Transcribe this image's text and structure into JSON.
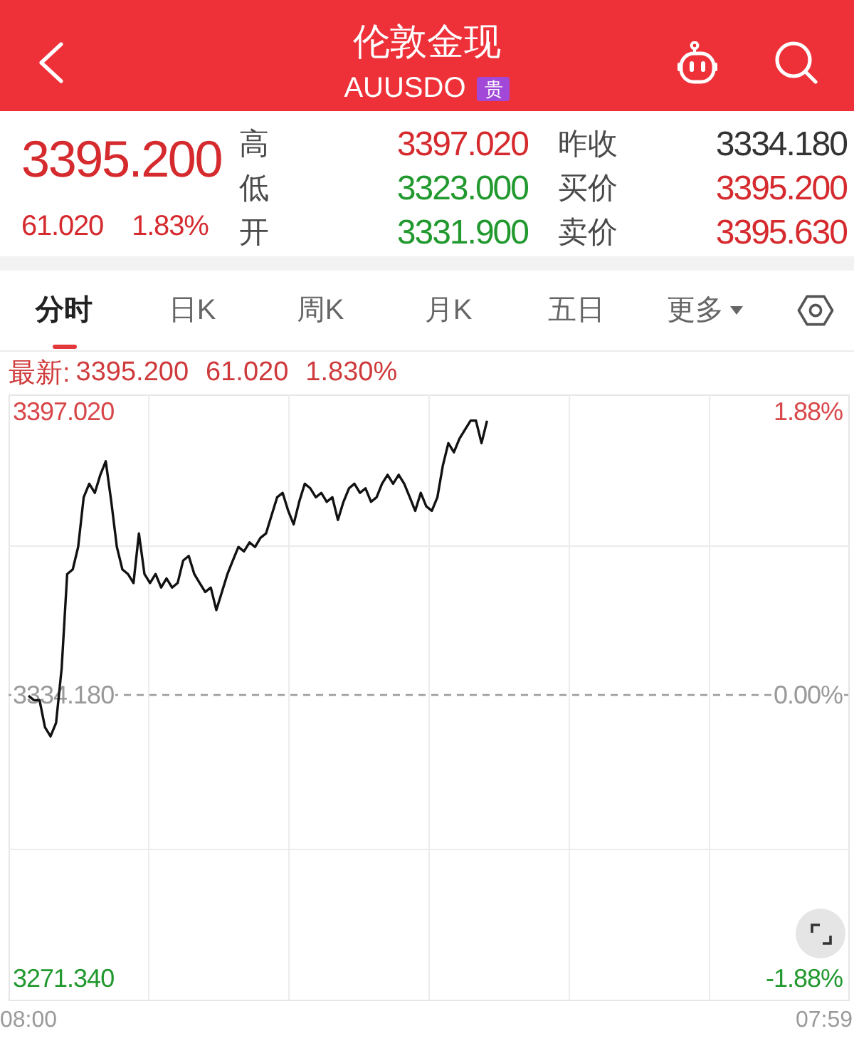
{
  "header": {
    "title": "伦敦金现",
    "symbol": "AUUSDO",
    "badge": "贵"
  },
  "quote": {
    "price": "3395.200",
    "change": "61.020",
    "percent": "1.83%",
    "color": "#d52a2e",
    "stats": [
      {
        "label": "高",
        "value": "3397.020",
        "color": "#d52a2e"
      },
      {
        "label": "昨收",
        "value": "3334.180",
        "color": "#333333"
      },
      {
        "label": "低",
        "value": "3323.000",
        "color": "#22992f"
      },
      {
        "label": "买价",
        "value": "3395.200",
        "color": "#d52a2e"
      },
      {
        "label": "开",
        "value": "3331.900",
        "color": "#22992f"
      },
      {
        "label": "卖价",
        "value": "3395.630",
        "color": "#d52a2e"
      }
    ]
  },
  "tabs": [
    {
      "label": "分时",
      "selected": true,
      "kind": "tab"
    },
    {
      "label": "日K",
      "selected": false,
      "kind": "tab"
    },
    {
      "label": "周K",
      "selected": false,
      "kind": "tab"
    },
    {
      "label": "月K",
      "selected": false,
      "kind": "tab"
    },
    {
      "label": "五日",
      "selected": false,
      "kind": "tab"
    },
    {
      "label": "更多",
      "selected": false,
      "kind": "menu"
    }
  ],
  "latest": {
    "label": "最新:",
    "price": "3395.200",
    "change": "61.020",
    "percent": "1.830%",
    "color": "#cf3a3c"
  },
  "chart": {
    "right_labels": [
      "1.88%",
      "0.00%",
      "-1.88%"
    ],
    "chart_data": {
      "type": "line",
      "categories": [
        "08:00",
        null,
        null,
        null,
        null,
        null,
        null,
        null,
        null,
        null,
        null,
        null,
        null,
        null,
        null,
        null,
        null,
        null,
        null,
        null,
        null,
        null,
        null,
        null,
        null,
        null,
        null,
        null,
        null,
        null,
        null,
        null,
        null,
        null,
        null,
        null,
        null,
        null,
        null,
        null,
        null,
        null,
        null,
        null,
        null,
        null,
        null,
        null,
        null,
        null,
        null,
        null,
        null,
        null,
        null,
        null,
        null,
        null,
        null,
        null,
        null,
        null,
        null,
        null,
        null,
        null,
        null,
        null,
        null,
        null,
        null,
        null,
        null,
        null,
        null,
        null,
        null,
        null,
        null,
        null,
        null,
        null,
        null,
        null,
        null,
        null,
        null,
        null,
        null,
        null,
        null,
        null,
        null,
        null,
        null,
        null,
        null,
        null,
        null,
        null,
        null,
        null,
        null,
        null,
        null,
        null,
        null,
        null,
        null,
        null,
        null,
        null,
        null,
        null,
        null,
        null,
        null,
        null,
        null,
        null,
        null,
        null,
        null,
        null,
        null,
        null,
        null,
        null,
        null,
        null,
        null,
        null,
        null,
        null,
        null,
        null,
        null,
        null,
        null,
        null,
        null,
        null,
        null,
        null,
        "07:59"
      ],
      "series": [
        {
          "color": "#111111",
          "values": [
            3334,
            3333,
            3333,
            3327,
            3325,
            3328,
            3340,
            3361,
            3362,
            3367,
            3378,
            3381,
            3379,
            3383,
            3386,
            3377,
            3367,
            3362,
            3361,
            3359,
            3370,
            3361,
            3359,
            3361,
            3358,
            3360,
            3358,
            3359,
            3364,
            3365,
            3361,
            3359,
            3357,
            3358,
            3353,
            3357,
            3361,
            3364,
            3367,
            3366,
            3368,
            3367,
            3369,
            3370,
            3374,
            3378,
            3379,
            3375,
            3372,
            3377,
            3381,
            3380,
            3378,
            3379,
            3377,
            3378,
            3373,
            3377,
            3380,
            3381,
            3379,
            3380,
            3377,
            3378,
            3381,
            3383,
            3381,
            3383,
            3381,
            3378,
            3375,
            3379,
            3376,
            3375,
            3378,
            3385,
            3390,
            3388,
            3391,
            3393,
            3395,
            3395,
            3390,
            3395,
            null,
            null,
            null,
            null,
            null,
            null,
            null,
            null,
            null,
            null,
            null,
            null,
            null,
            null,
            null,
            null,
            null,
            null,
            null,
            null,
            null,
            null,
            null,
            null,
            null,
            null,
            null,
            null,
            null,
            null,
            null,
            null,
            null,
            null,
            null,
            null,
            null,
            null,
            null,
            null,
            null,
            null,
            null,
            null,
            null,
            null,
            null,
            null,
            null,
            null,
            null,
            null,
            null,
            null,
            null,
            null,
            null,
            null,
            null,
            null,
            null
          ]
        }
      ],
      "ylim": [
        3266.29,
        3400.81
      ],
      "yticks": [
        {
          "value": 3397.02,
          "label": "3397.020"
        },
        {
          "value": 3334.18,
          "label": "3334.180"
        },
        {
          "value": 3271.34,
          "label": "3271.340"
        }
      ],
      "ref_lines": [
        {
          "axis": "y",
          "value": 3334.18
        }
      ]
    }
  }
}
